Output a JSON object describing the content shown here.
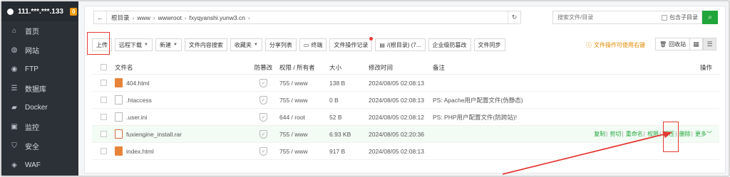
{
  "sidebar": {
    "host": "111.***.***.133",
    "badge": "0",
    "items": [
      {
        "label": "首页",
        "icon": "home-icon"
      },
      {
        "label": "网站",
        "icon": "globe-icon"
      },
      {
        "label": "FTP",
        "icon": "ftp-icon"
      },
      {
        "label": "数据库",
        "icon": "database-icon"
      },
      {
        "label": "Docker",
        "icon": "docker-icon"
      },
      {
        "label": "监控",
        "icon": "monitor-icon"
      },
      {
        "label": "安全",
        "icon": "security-icon"
      },
      {
        "label": "WAF",
        "icon": "waf-icon"
      }
    ]
  },
  "path": {
    "crumbs": [
      "根目录",
      "www",
      "wwwroot",
      "fxyqyanshi.yunw3.cn"
    ]
  },
  "search": {
    "placeholder": "搜索文件/目录",
    "subdir_label": "包含子目录"
  },
  "toolbar": {
    "upload": "上传",
    "remote_download": "远程下载",
    "new": "新建",
    "content_search": "文件内容搜索",
    "favorites": "收藏夹",
    "share_list": "分享列表",
    "terminal": "终端",
    "file_log": "文件操作记录",
    "root_dir": "/(根目录) (7...",
    "enterprise_tamper": "企业级防篡改",
    "file_sync": "文件同步"
  },
  "hint": "文件操作可使用右键",
  "recycle": "回收站",
  "table": {
    "headers": {
      "name": "文件名",
      "anti": "防篡改",
      "perm": "权限 / 所有者",
      "size": "大小",
      "time": "修改时间",
      "note": "备注",
      "ops": "操作"
    },
    "rows": [
      {
        "name": "404.html",
        "type": "html",
        "perm": "755 / www",
        "size": "138 B",
        "time": "2024/08/05 02:08:13",
        "note": ""
      },
      {
        "name": ".htaccess",
        "type": "cfg",
        "perm": "755 / www",
        "size": "0 B",
        "time": "2024/08/05 02:08:13",
        "note": "PS: Apache用户配置文件(伪静态)"
      },
      {
        "name": ".user.ini",
        "type": "cfg",
        "perm": "644 / root",
        "size": "52 B",
        "time": "2024/08/05 02:08:12",
        "note": "PS: PHP用户配置文件(防跨站)!"
      },
      {
        "name": "fuxiengine_install.rar",
        "type": "rar",
        "perm": "755 / www",
        "size": "6.93 KB",
        "time": "2024/08/05 02:20:36",
        "note": ""
      },
      {
        "name": "index.html",
        "type": "html",
        "perm": "755 / www",
        "size": "917 B",
        "time": "2024/08/05 02:08:13",
        "note": ""
      }
    ],
    "row_ops": {
      "copy": "复制",
      "cut": "剪切",
      "rename": "重命名",
      "perm": "权限",
      "unzip": "解压",
      "delete": "删除",
      "more": "更多"
    }
  },
  "colors": {
    "accent": "#20a53a",
    "sidebar_bg": "#2c3138",
    "annotation": "#e53935",
    "badge": "#f39c12",
    "hint": "#e08a00"
  }
}
